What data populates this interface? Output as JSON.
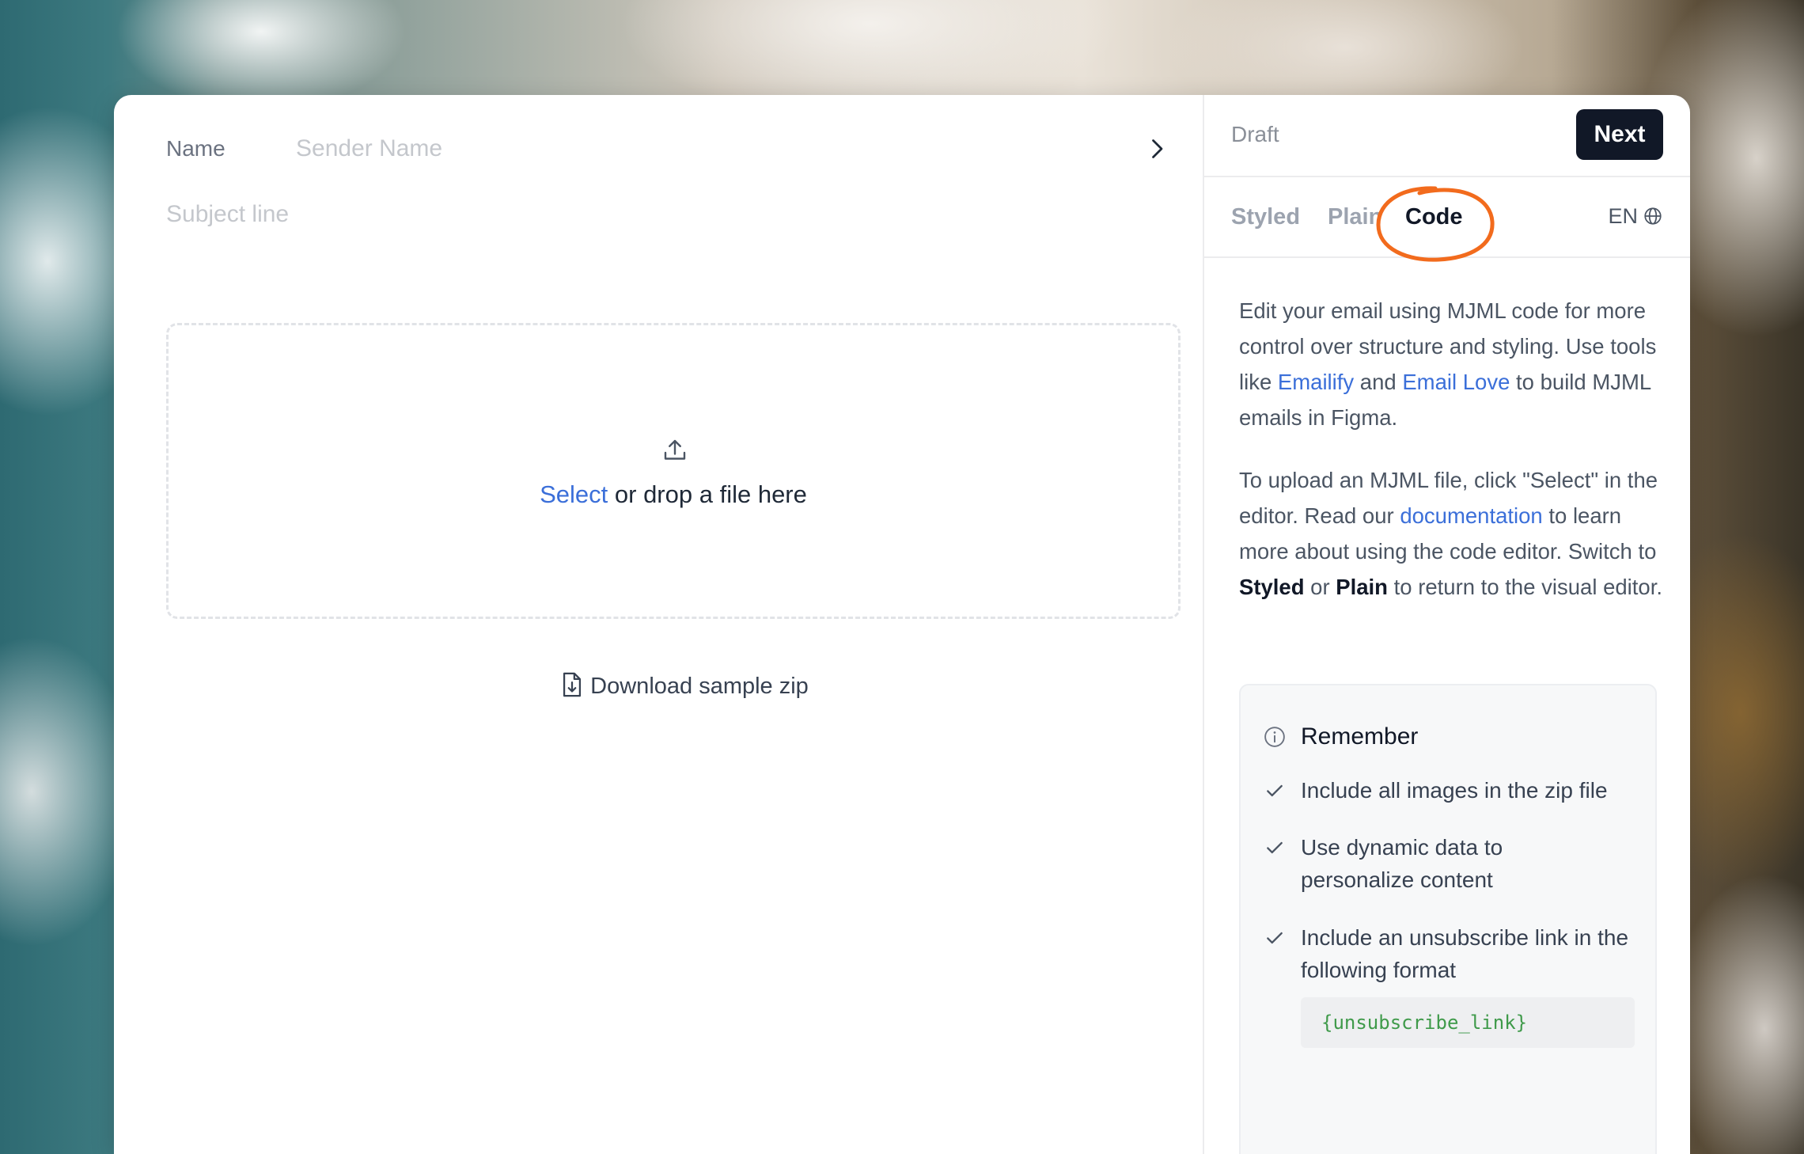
{
  "form": {
    "name_label": "Name",
    "sender_placeholder": "Sender Name",
    "sender_value": "",
    "subject_placeholder": "Subject line",
    "subject_value": ""
  },
  "dropzone": {
    "select_link": "Select",
    "rest_text": " or drop a file here"
  },
  "download": {
    "label": "Download sample zip"
  },
  "header": {
    "status": "Draft",
    "next_label": "Next"
  },
  "tabs": [
    {
      "label": "Styled"
    },
    {
      "label": "Plain"
    },
    {
      "label": "Code",
      "active": true
    }
  ],
  "language": "EN",
  "description": {
    "p1_a": "Edit your email using MJML code for more control over structure and styling. Use tools like ",
    "p1_link1": "Emailify",
    "p1_b": " and ",
    "p1_link2": "Email Love",
    "p1_c": " to build MJML emails in Figma.",
    "p2_a": "To upload an MJML file, click \"Select\" in the editor. Read our ",
    "p2_link": "documentation",
    "p2_b": " to learn more about using the code editor. Switch to ",
    "p2_strong1": "Styled",
    "p2_c": " or ",
    "p2_strong2": "Plain",
    "p2_d": " to return to the visual editor."
  },
  "remember": {
    "title": "Remember",
    "items": [
      "Include all images in the zip file",
      "Use dynamic data to personalize content",
      "Include an unsubscribe link in the following format"
    ],
    "code": "{unsubscribe_link}"
  },
  "colors": {
    "accent_link": "#3b6fd9",
    "primary_button": "#111827",
    "annotation_circle": "#f26b1d",
    "code_text": "#3f9a4a"
  },
  "icons": [
    "chevron-right-icon",
    "upload-icon",
    "file-download-icon",
    "send-icon",
    "globe-icon",
    "info-icon",
    "check-icon"
  ]
}
